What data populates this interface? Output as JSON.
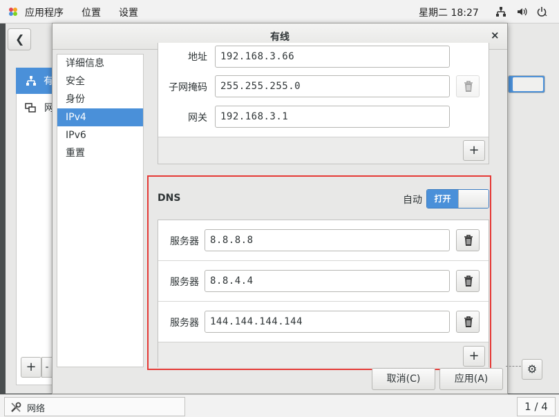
{
  "topbar": {
    "apps_label": "应用程序",
    "places_label": "位置",
    "settings_label": "设置",
    "clock": "星期二 18:27"
  },
  "background_window": {
    "list_selected_label": "有",
    "list_item_label": "网"
  },
  "dialog": {
    "title": "有线",
    "close": "×",
    "sidebar": [
      "详细信息",
      "安全",
      "身份",
      "IPv4",
      "IPv6",
      "重置"
    ],
    "sidebar_active_index": 3,
    "ipv4": {
      "address_label": "地址",
      "address_value": "192.168.3.66",
      "netmask_label": "子网掩码",
      "netmask_value": "255.255.255.0",
      "gateway_label": "网关",
      "gateway_value": "192.168.3.1",
      "add_label": "+"
    },
    "dns": {
      "title": "DNS",
      "auto_label": "自动",
      "toggle_label": "打开",
      "servers": [
        {
          "label": "服务器",
          "value": "8.8.8.8"
        },
        {
          "label": "服务器",
          "value": "8.8.4.4"
        },
        {
          "label": "服务器",
          "value": "144.144.144.144"
        }
      ],
      "add_label": "+"
    },
    "cancel_label": "取消(C)",
    "apply_label": "应用(A)"
  },
  "taskbar": {
    "task_label": "网络",
    "pager": "1 / 4"
  },
  "colors": {
    "accent": "#4a90d9",
    "highlight_frame": "#e53935"
  }
}
